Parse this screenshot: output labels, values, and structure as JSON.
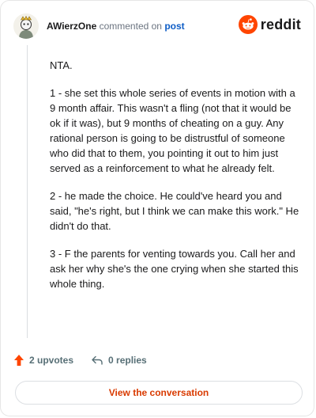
{
  "header": {
    "username": "AWierzOne",
    "commented_on_text": "commented on",
    "post_link": "post",
    "brand_word": "reddit"
  },
  "comment": {
    "paragraphs": [
      "NTA.",
      "1 - she set this whole series of events in motion with a 9 month affair. This wasn't a fling (not that it would be ok if it was), but 9 months of cheating on a guy. Any rational person is going to be distrustful of someone who did that to them, you pointing it out to him just served as a reinforcement to what he already felt.",
      "2 - he made the choice. He could've heard you and said, \"he's right, but I think we can make this work.\" He didn't do that.",
      "3 - F the parents for venting towards you. Call her and ask her why she's the one crying when she started this whole thing."
    ]
  },
  "actions": {
    "upvotes": "2 upvotes",
    "replies": "0 replies"
  },
  "cta": {
    "label": "View the conversation"
  },
  "colors": {
    "reddit_orange": "#ff4500",
    "link_blue": "#0e5dc6",
    "cta_text": "#d93a00"
  }
}
